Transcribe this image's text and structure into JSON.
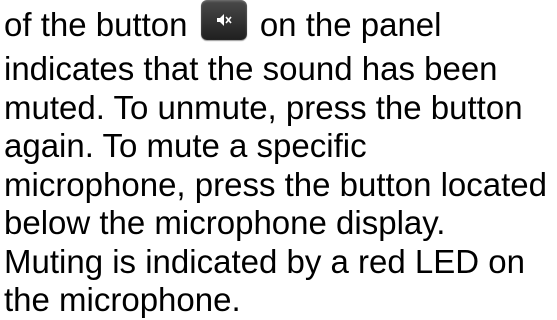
{
  "document": {
    "line1_before": "of the button",
    "line1_after": "on the panel",
    "lines": [
      "indicates that the sound has been",
      "muted. To unmute, press the button",
      "again. To mute a specific",
      "microphone, press the button located",
      "below the microphone display.",
      "Muting is indicated by a red LED on",
      "the microphone."
    ],
    "inline_icon": "speaker-mute-icon"
  }
}
